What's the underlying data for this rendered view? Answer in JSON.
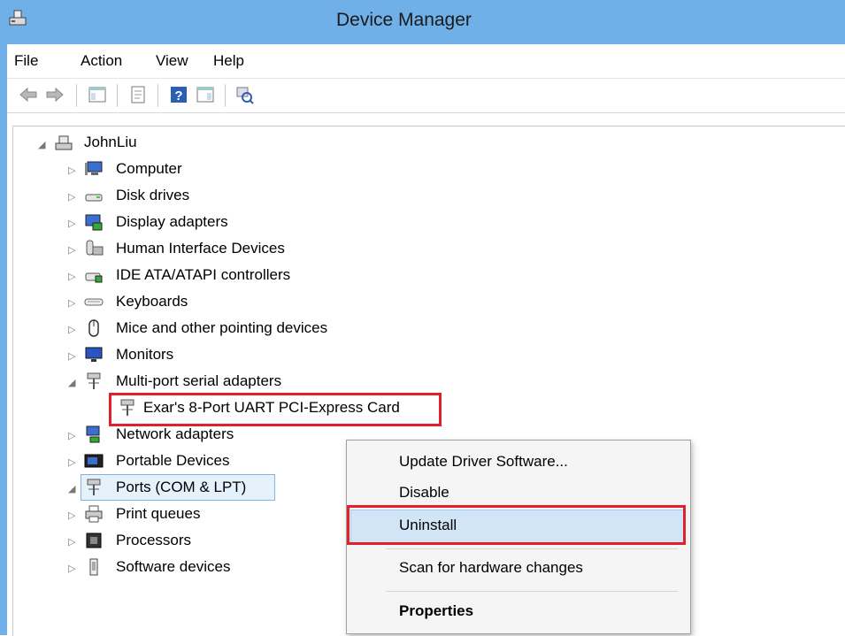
{
  "window": {
    "title": "Device Manager"
  },
  "menu": {
    "file": "File",
    "action": "Action",
    "view": "View",
    "help": "Help"
  },
  "tree": {
    "root": "JohnLiu",
    "items": [
      {
        "label": "Computer",
        "icon": "computer-icon"
      },
      {
        "label": "Disk drives",
        "icon": "disk-drive-icon"
      },
      {
        "label": "Display adapters",
        "icon": "display-adapter-icon"
      },
      {
        "label": "Human Interface Devices",
        "icon": "hid-icon"
      },
      {
        "label": "IDE ATA/ATAPI controllers",
        "icon": "ide-controller-icon"
      },
      {
        "label": "Keyboards",
        "icon": "keyboard-icon"
      },
      {
        "label": "Mice and other pointing devices",
        "icon": "mouse-icon"
      },
      {
        "label": "Monitors",
        "icon": "monitor-icon"
      },
      {
        "label": "Multi-port serial adapters",
        "icon": "serial-adapter-icon"
      },
      {
        "label": "Exar's 8-Port UART PCI-Express Card",
        "icon": "serial-adapter-icon"
      },
      {
        "label": "Network adapters",
        "icon": "network-adapter-icon"
      },
      {
        "label": "Portable Devices",
        "icon": "portable-device-icon"
      },
      {
        "label": "Ports (COM & LPT)",
        "icon": "port-icon"
      },
      {
        "label": "Print queues",
        "icon": "printer-icon"
      },
      {
        "label": "Processors",
        "icon": "processor-icon"
      },
      {
        "label": "Software devices",
        "icon": "software-device-icon"
      }
    ]
  },
  "context_menu": {
    "update": "Update Driver Software...",
    "disable": "Disable",
    "uninstall": "Uninstall",
    "scan": "Scan for hardware changes",
    "properties": "Properties"
  },
  "colors": {
    "titlebar": "#6fb0e8",
    "highlight": "#e0202a",
    "selection": "#e5f1fb",
    "hover": "#d2e5f7"
  }
}
